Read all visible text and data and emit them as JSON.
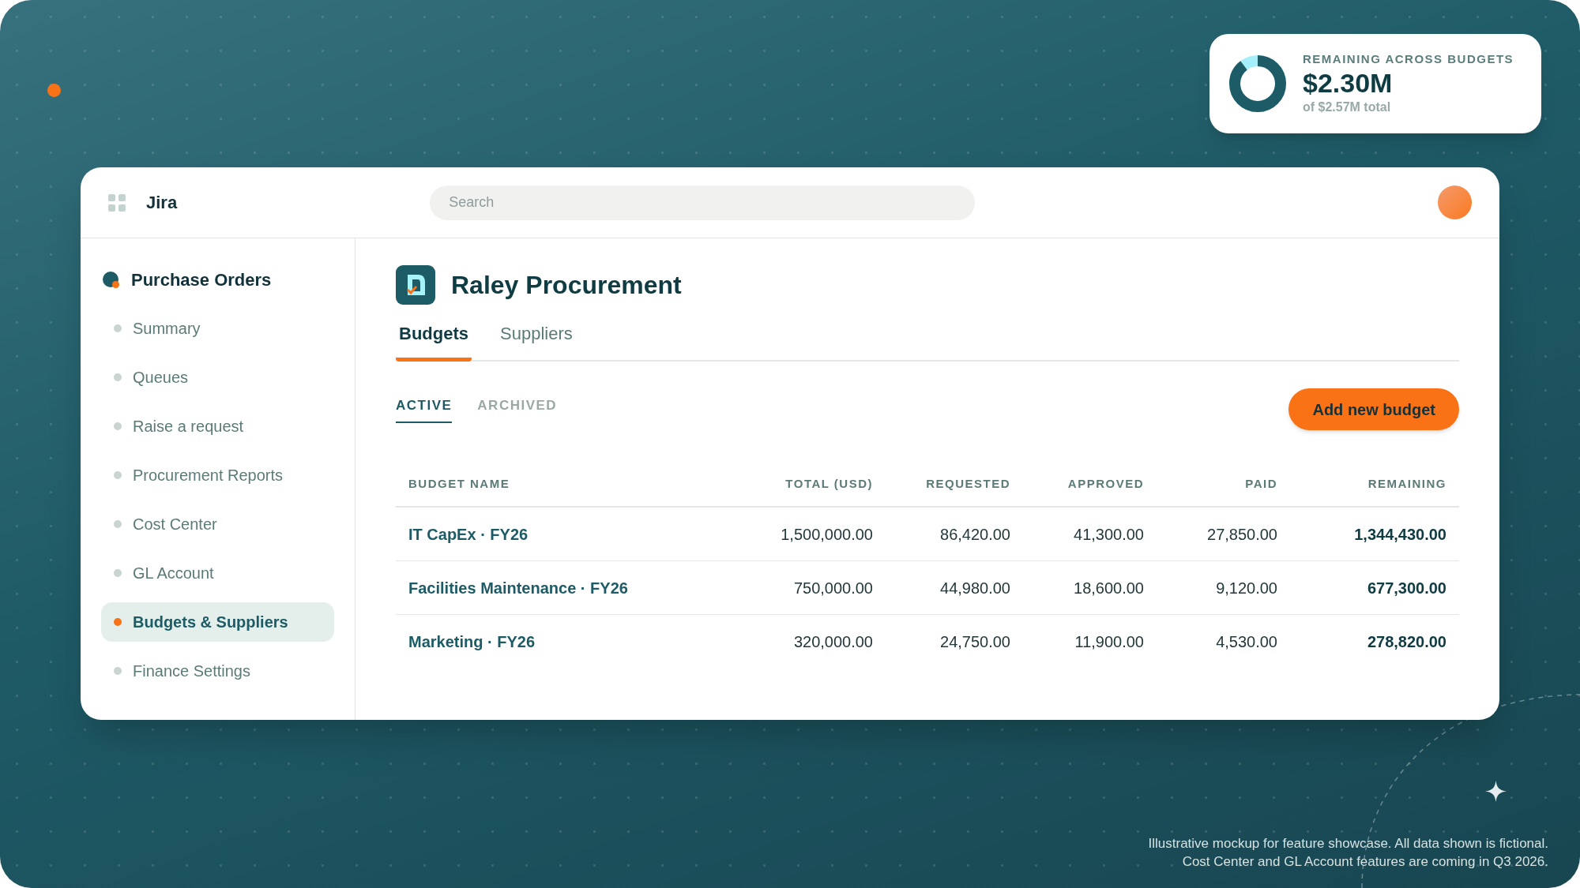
{
  "summary_card": {
    "label": "REMAINING ACROSS BUDGETS",
    "value": "$2.30M",
    "subtext": "of $2.57M total"
  },
  "app": {
    "name": "Jira",
    "search": {
      "placeholder": "Search"
    }
  },
  "sidebar": {
    "title": "Purchase Orders",
    "items": [
      {
        "label": "Summary",
        "selected": false
      },
      {
        "label": "Queues",
        "selected": false
      },
      {
        "label": "Raise a request",
        "selected": false
      },
      {
        "label": "Procurement Reports",
        "selected": false
      },
      {
        "label": "Cost Center",
        "selected": false
      },
      {
        "label": "GL Account",
        "selected": false
      },
      {
        "label": "Budgets & Suppliers",
        "selected": true
      },
      {
        "label": "Finance Settings",
        "selected": false
      }
    ]
  },
  "project": {
    "title": "Raley Procurement"
  },
  "tabs": [
    {
      "label": "Budgets",
      "selected": true
    },
    {
      "label": "Suppliers",
      "selected": false
    }
  ],
  "subtabs": [
    {
      "label": "ACTIVE",
      "selected": true
    },
    {
      "label": "ARCHIVED",
      "selected": false
    }
  ],
  "add_button": "Add new budget",
  "table": {
    "columns": [
      "BUDGET NAME",
      "TOTAL (USD)",
      "REQUESTED",
      "APPROVED",
      "PAID",
      "REMAINING"
    ],
    "rows": [
      [
        "IT CapEx · FY26",
        "1,500,000.00",
        "86,420.00",
        "41,300.00",
        "27,850.00",
        "1,344,430.00"
      ],
      [
        "Facilities Maintenance · FY26",
        "750,000.00",
        "44,980.00",
        "18,600.00",
        "9,120.00",
        "677,300.00"
      ],
      [
        "Marketing · FY26",
        "320,000.00",
        "24,750.00",
        "11,900.00",
        "4,530.00",
        "278,820.00"
      ]
    ]
  },
  "footnote": [
    "Illustrative mockup for feature showcase. All data shown is fictional.",
    "Cost Center and GL Account features are coming in Q3 2026."
  ]
}
